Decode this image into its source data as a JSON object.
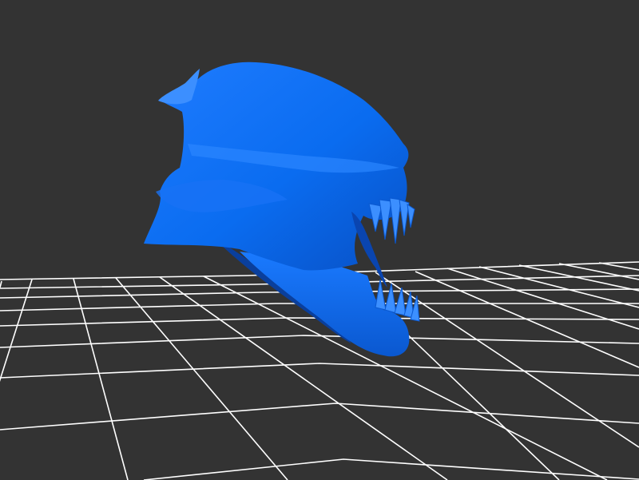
{
  "viewport": {
    "background_color": "#333333",
    "grid_color": "#ffffff",
    "model_color": "#0a6cf0",
    "model_shadow_color": "#0a3f9c",
    "model_highlight_color": "#3c8fff"
  }
}
